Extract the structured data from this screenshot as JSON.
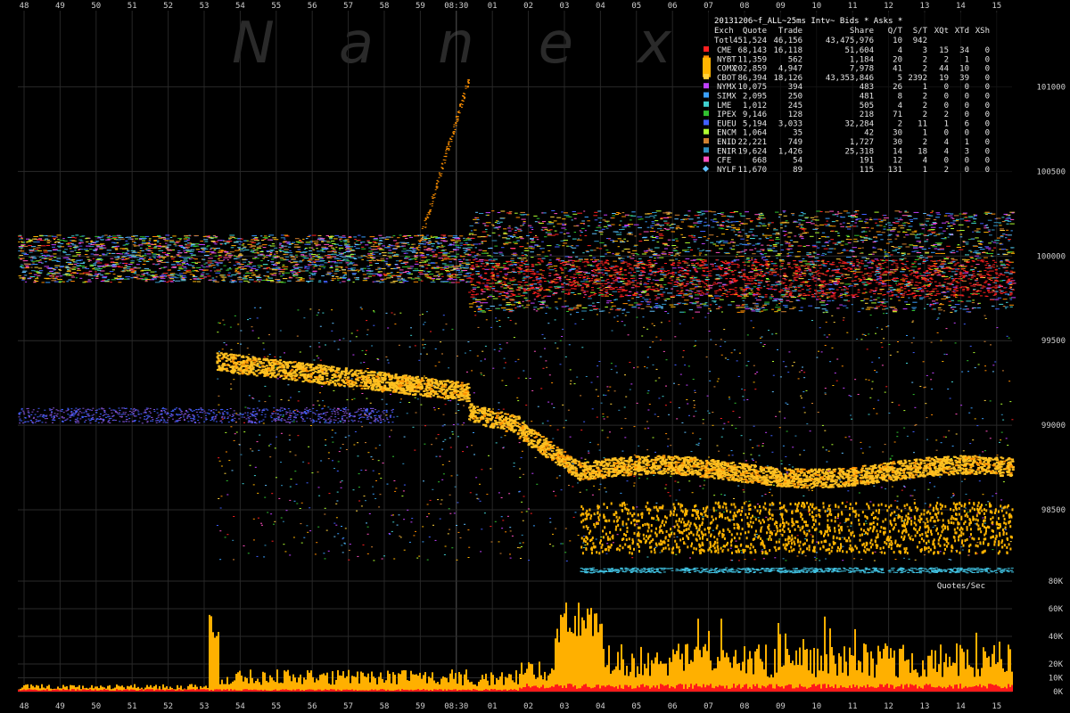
{
  "chart_data": [
    {
      "type": "scatter",
      "title": "20131206~f_ALL~25ms Intv~ Bids * Asks *",
      "watermark": "Nanex",
      "time_ticks_top": [
        "48",
        "49",
        "50",
        "51",
        "52",
        "53",
        "54",
        "55",
        "56",
        "57",
        "58",
        "59",
        "08:30",
        "01",
        "02",
        "03",
        "04",
        "05",
        "06",
        "07",
        "08",
        "09",
        "10",
        "11",
        "12",
        "13",
        "14",
        "15"
      ],
      "y_ticks": [
        "101000",
        "100500",
        "100000",
        "99500",
        "99000",
        "98500"
      ],
      "ylim": [
        98100,
        101450
      ],
      "grid": true,
      "legend_placement": "top-right",
      "legend_headers": [
        "Exch",
        "Quote",
        "Trade",
        "Share",
        "Q/T",
        "S/T",
        "XQt",
        "XTd",
        "XSh"
      ],
      "legend_total": {
        "label": "Totl",
        "quote": "451,524",
        "trade": "46,156",
        "share": "43,475,976",
        "qt": "10",
        "st": "942",
        "xqt": "",
        "xtd": "",
        "xsh": ""
      },
      "legend_rows": [
        {
          "exch": "CME",
          "quote": "68,143",
          "trade": "16,118",
          "share": "51,604",
          "qt": "4",
          "st": "3",
          "xqt": "15",
          "xtd": "34",
          "xsh": "0",
          "color": "#ff2020"
        },
        {
          "exch": "NYBT",
          "quote": "11,359",
          "trade": "562",
          "share": "1,184",
          "qt": "20",
          "st": "2",
          "xqt": "2",
          "xtd": "1",
          "xsh": "0",
          "color": "#ff8c00"
        },
        {
          "exch": "COMX",
          "quote": "202,859",
          "trade": "4,947",
          "share": "7,978",
          "qt": "41",
          "st": "2",
          "xqt": "44",
          "xtd": "10",
          "xsh": "0",
          "color": "#ffb400"
        },
        {
          "exch": "CBOT",
          "quote": "86,394",
          "trade": "18,126",
          "share": "43,353,846",
          "qt": "5",
          "st": "2392",
          "xqt": "19",
          "xtd": "39",
          "xsh": "0",
          "color": "#ffd23c"
        },
        {
          "exch": "NYMX",
          "quote": "10,075",
          "trade": "394",
          "share": "483",
          "qt": "26",
          "st": "1",
          "xqt": "0",
          "xtd": "0",
          "xsh": "0",
          "color": "#c040ff"
        },
        {
          "exch": "SIMX",
          "quote": "2,095",
          "trade": "250",
          "share": "481",
          "qt": "8",
          "st": "2",
          "xqt": "0",
          "xtd": "0",
          "xsh": "0",
          "color": "#3aa0ff"
        },
        {
          "exch": "LME",
          "quote": "1,012",
          "trade": "245",
          "share": "505",
          "qt": "4",
          "st": "2",
          "xqt": "0",
          "xtd": "0",
          "xsh": "0",
          "color": "#40d0d0"
        },
        {
          "exch": "IPEX",
          "quote": "9,146",
          "trade": "128",
          "share": "218",
          "qt": "71",
          "st": "2",
          "xqt": "2",
          "xtd": "0",
          "xsh": "0",
          "color": "#30c030"
        },
        {
          "exch": "EUEU",
          "quote": "5,194",
          "trade": "3,033",
          "share": "32,284",
          "qt": "2",
          "st": "11",
          "xqt": "1",
          "xtd": "6",
          "xsh": "0",
          "color": "#4060ff"
        },
        {
          "exch": "ENCM",
          "quote": "1,064",
          "trade": "35",
          "share": "42",
          "qt": "30",
          "st": "1",
          "xqt": "0",
          "xtd": "0",
          "xsh": "0",
          "color": "#b0ff30"
        },
        {
          "exch": "ENID",
          "quote": "22,221",
          "trade": "749",
          "share": "1,727",
          "qt": "30",
          "st": "2",
          "xqt": "4",
          "xtd": "1",
          "xsh": "0",
          "color": "#d08030"
        },
        {
          "exch": "ENIR",
          "quote": "19,624",
          "trade": "1,426",
          "share": "25,318",
          "qt": "14",
          "st": "18",
          "xqt": "4",
          "xtd": "3",
          "xsh": "0",
          "color": "#3090c0"
        },
        {
          "exch": "CFE",
          "quote": "668",
          "trade": "54",
          "share": "191",
          "qt": "12",
          "st": "4",
          "xqt": "0",
          "xtd": "0",
          "xsh": "0",
          "color": "#ff50c0"
        },
        {
          "exch": "NYLF",
          "quote": "11,670",
          "trade": "89",
          "share": "115",
          "qt": "131",
          "st": "1",
          "xqt": "2",
          "xtd": "0",
          "xsh": "0",
          "color": "#60c0ff"
        }
      ]
    },
    {
      "type": "area",
      "ylabel": "Quotes/Sec",
      "y_ticks": [
        "80K",
        "60K",
        "40K",
        "20K",
        "10K",
        "0K"
      ],
      "y_tick_values": [
        80000,
        60000,
        40000,
        20000,
        10000,
        0
      ],
      "ylim": [
        0,
        80000
      ],
      "time_ticks_bottom": [
        "48",
        "49",
        "50",
        "51",
        "52",
        "53",
        "54",
        "55",
        "56",
        "57",
        "58",
        "59",
        "08:30",
        "01",
        "02",
        "03",
        "04",
        "05",
        "06",
        "07",
        "08",
        "09",
        "10",
        "11",
        "12",
        "13",
        "14",
        "15"
      ],
      "colors": {
        "cboe_base": "#ff1a1a",
        "comx_stack": "#ffb000",
        "cbot_stack": "#40c0ff"
      }
    }
  ]
}
